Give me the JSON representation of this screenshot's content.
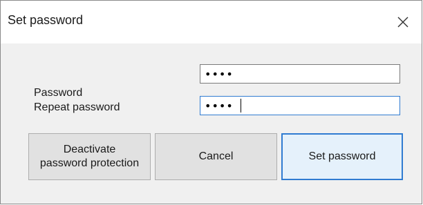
{
  "window": {
    "title": "Set password",
    "close_icon": "close-icon"
  },
  "form": {
    "password_label": "Password",
    "password_value": "••••",
    "repeat_label": "Repeat password",
    "repeat_value": "••••"
  },
  "buttons": {
    "deactivate_line1": "Deactivate",
    "deactivate_line2": "password protection",
    "cancel": "Cancel",
    "set": "Set password"
  },
  "colors": {
    "focus_accent": "#2f7bd1",
    "window_bg": "#f0f0f0",
    "button_bg": "#e1e1e1"
  }
}
